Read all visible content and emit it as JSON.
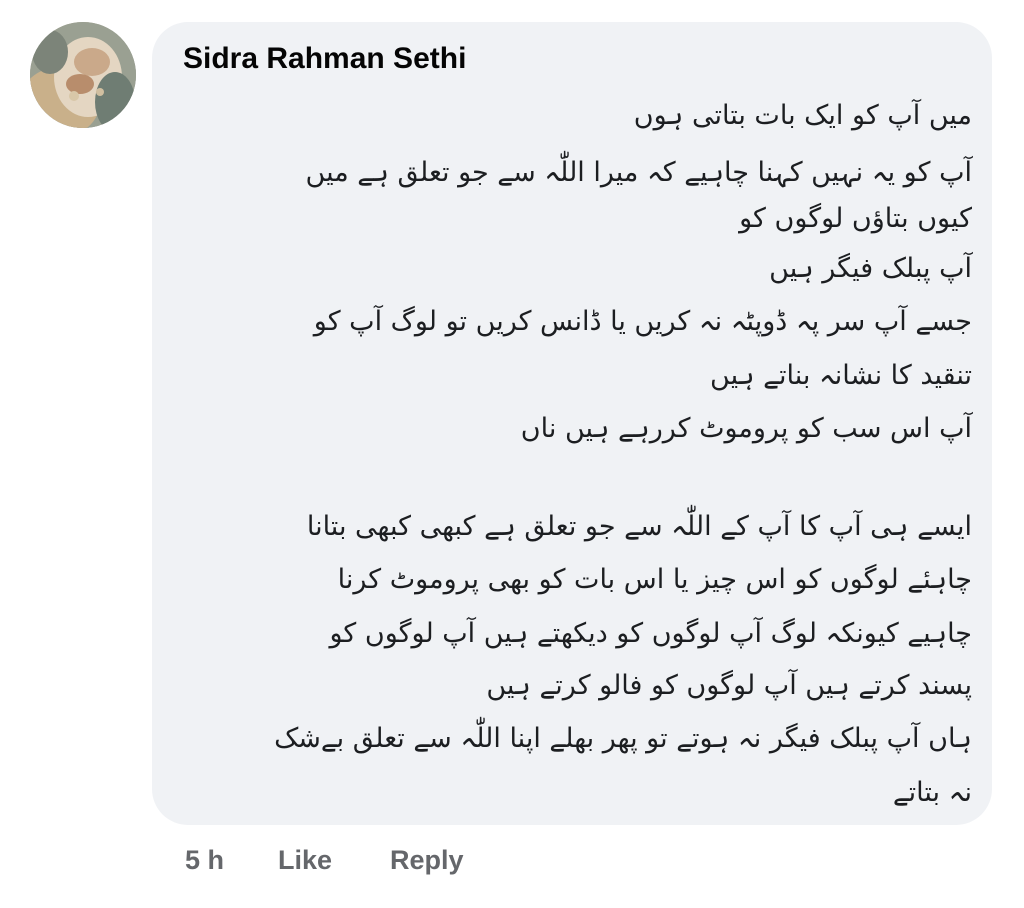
{
  "comment": {
    "author": "Sidra Rahman Sethi",
    "avatar_icon": "profile-photo",
    "lines": [
      "میں آپ کو ایک بات بتاتی ہوں",
      "آپ کو یہ نہیں کہنا چاہیے کہ میرا اللّٰہ سے جو تعلق ہے میں",
      "کیوں بتاؤں لوگوں کو",
      "آپ پبلک فیگر ہیں",
      "جسے آپ سر پہ ڈوپٹہ نہ کریں یا ڈانس کریں تو لوگ آپ کو",
      "تنقید کا نشانہ بناتے ہیں",
      "آپ اس سب کو پروموٹ کررہے ہیں ناں",
      "ایسے ہی آپ کا آپ کے اللّٰہ سے جو تعلق ہے کبھی کبھی بتانا",
      "چاہئے لوگوں کو اس چیز یا اس بات کو بھی پروموٹ کرنا",
      "چاہیے کیونکہ لوگ آپ لوگوں کو دیکھتے ہیں آپ لوگوں کو",
      "پسند کرتے ہیں آپ لوگوں کو فالو کرتے ہیں",
      "ہاں آپ پبلک فیگر نہ ہوتے تو پھر بھلے اپنا اللّٰہ سے تعلق بےشک",
      "نہ بتاتے"
    ]
  },
  "actions": {
    "time": "5 h",
    "like_label": "Like",
    "reply_label": "Reply"
  },
  "colors": {
    "bubble_bg": "#f0f2f5",
    "author": "#050505",
    "meta": "#65676b"
  }
}
